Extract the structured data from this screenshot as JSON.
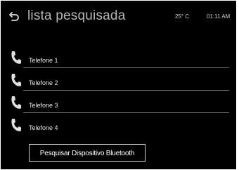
{
  "header": {
    "back_icon": "back-arrow-icon",
    "title": "lista pesquisada",
    "temperature": "25° C",
    "time": "01:11 AM"
  },
  "devices": [
    {
      "label": "Telefone 1",
      "icon": "phone-handset-icon"
    },
    {
      "label": "Telefone 2",
      "icon": "phone-handset-icon"
    },
    {
      "label": "Telefone 3",
      "icon": "phone-handset-icon"
    },
    {
      "label": "Telefone 4",
      "icon": "phone-handset-icon"
    }
  ],
  "actions": {
    "search_bluetooth_label": "Pesquisar Dispositivo Bluetooth"
  },
  "colors": {
    "background": "#000000",
    "text": "#e8e8e8",
    "title": "#b8b8b8",
    "divider": "#7a7a7a",
    "button_border": "#d0d0d0"
  }
}
